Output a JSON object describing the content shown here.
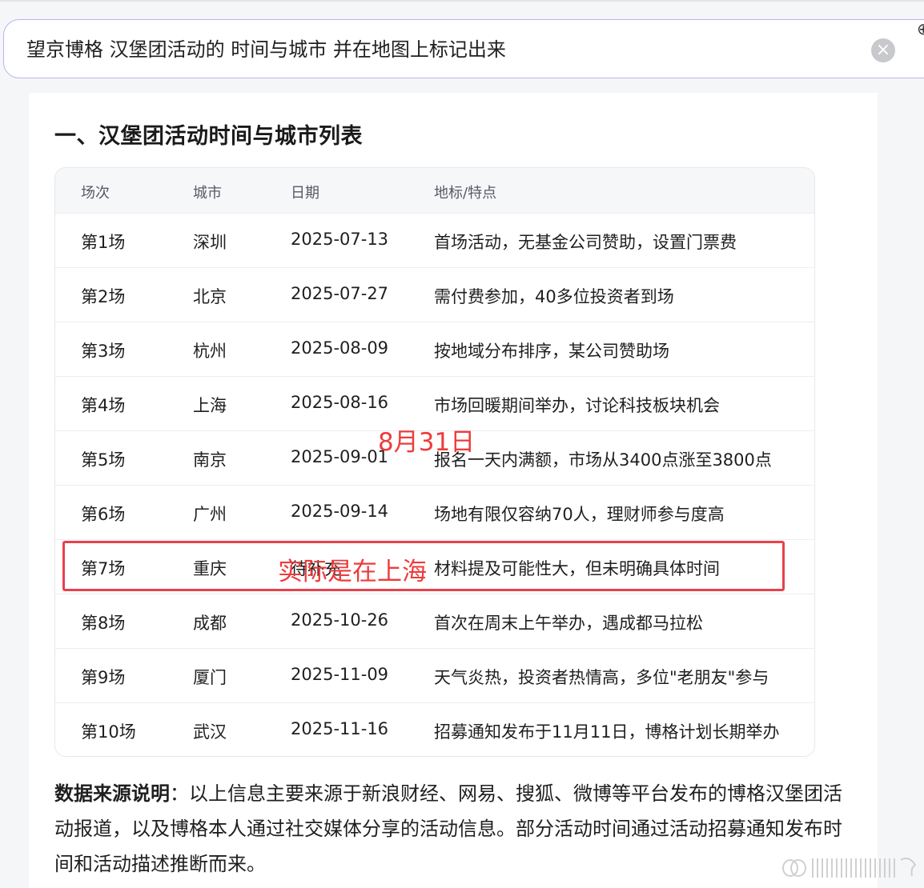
{
  "search": {
    "query": "望京博格 汉堡团活动的 时间与城市 并在地图上标记出来"
  },
  "section": {
    "title": "一、汉堡团活动时间与城市列表"
  },
  "table": {
    "headers": [
      "场次",
      "城市",
      "日期",
      "地标/特点"
    ],
    "rows": [
      [
        "第1场",
        "深圳",
        "2025-07-13",
        "首场活动，无基金公司赞助，设置门票费"
      ],
      [
        "第2场",
        "北京",
        "2025-07-27",
        "需付费参加，40多位投资者到场"
      ],
      [
        "第3场",
        "杭州",
        "2025-08-09",
        "按地域分布排序，某公司赞助场"
      ],
      [
        "第4场",
        "上海",
        "2025-08-16",
        "市场回暖期间举办，讨论科技板块机会"
      ],
      [
        "第5场",
        "南京",
        "2025-09-01",
        "报名一天内满额，市场从3400点涨至3800点"
      ],
      [
        "第6场",
        "广州",
        "2025-09-14",
        "场地有限仅容纳70人，理财师参与度高"
      ],
      [
        "第7场",
        "重庆",
        "待补充",
        "材料提及可能性大，但未明确具体时间"
      ],
      [
        "第8场",
        "成都",
        "2025-10-26",
        "首次在周末上午举办，遇成都马拉松"
      ],
      [
        "第9场",
        "厦门",
        "2025-11-09",
        "天气炎热，投资者热情高，多位\"老朋友\"参与"
      ],
      [
        "第10场",
        "武汉",
        "2025-11-16",
        "招募通知发布于11月11日，博格计划长期举办"
      ]
    ]
  },
  "annotations": {
    "date_note": "8月31日",
    "location_note": "实际是在上海",
    "color": "#e8414a"
  },
  "source": {
    "label": "数据来源说明",
    "text": "：以上信息主要来源于新浪财经、网易、搜狐、微博等平台发布的博格汉堡团活动报道，以及博格本人通过社交媒体分享的活动信息。部分活动时间通过活动招募通知发布时间和活动描述推断而来。"
  },
  "icons": {
    "clear": "close-circle-icon"
  }
}
